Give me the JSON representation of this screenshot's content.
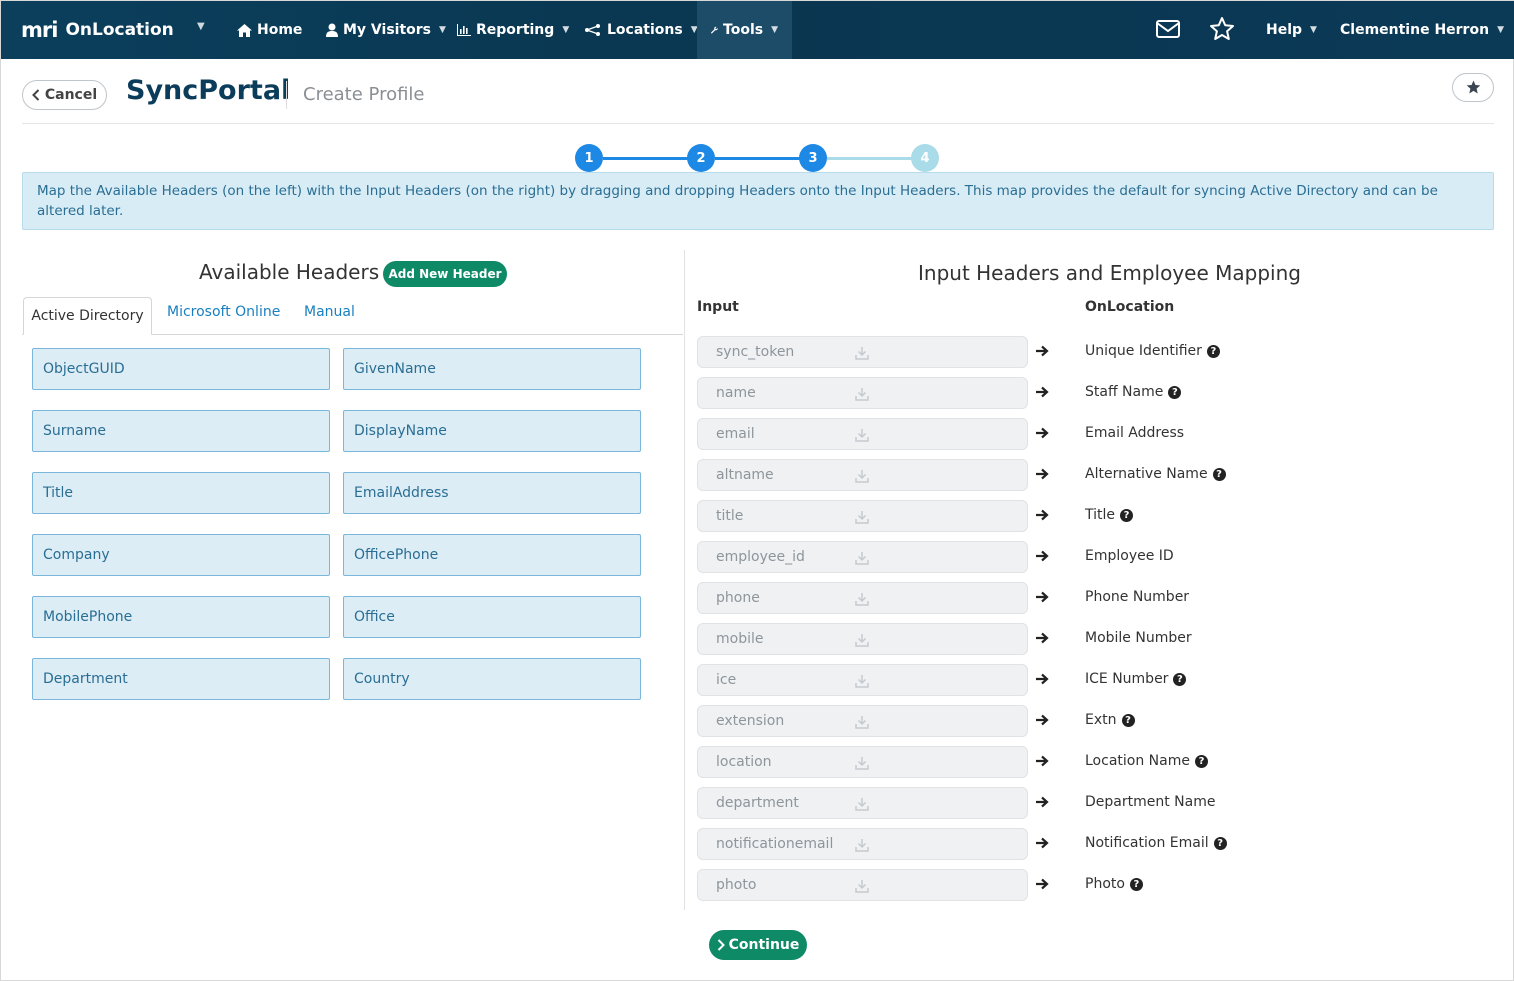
{
  "nav": {
    "brand_logo": "mri",
    "brand_name": "OnLocation",
    "items": [
      {
        "label": "Home",
        "icon": "home-icon"
      },
      {
        "label": "My Visitors",
        "icon": "user-icon"
      },
      {
        "label": "Reporting",
        "icon": "bar-chart-icon"
      },
      {
        "label": "Locations",
        "icon": "nodes-icon"
      },
      {
        "label": "Tools",
        "icon": "wrench-icon"
      }
    ],
    "help_label": "Help",
    "user_label": "Clementine Herron"
  },
  "header": {
    "cancel_label": "Cancel",
    "title": "SyncPortal",
    "subtitle": "Create Profile"
  },
  "stepper": {
    "steps": [
      "1",
      "2",
      "3",
      "4"
    ],
    "current_step": 3,
    "active_color": "#1e88e5",
    "inactive_color": "#a9dbe9"
  },
  "info_text": "Map the Available Headers (on the left) with the Input Headers (on the right) by dragging and dropping Headers onto the Input Headers. This map provides the default for syncing Active Directory and can be altered later.",
  "available": {
    "title": "Available Headers",
    "add_button": "Add New Header",
    "tabs": [
      "Active Directory",
      "Microsoft Online",
      "Manual"
    ],
    "active_tab": "Active Directory",
    "headers": [
      "ObjectGUID",
      "GivenName",
      "Surname",
      "DisplayName",
      "Title",
      "EmailAddress",
      "Company",
      "OfficePhone",
      "MobilePhone",
      "Office",
      "Department",
      "Country"
    ]
  },
  "mapping": {
    "title": "Input Headers and Employee Mapping",
    "input_col": "Input",
    "onlocation_col": "OnLocation",
    "rows": [
      {
        "input": "sync_token",
        "target": "Unique Identifier",
        "help": true
      },
      {
        "input": "name",
        "target": "Staff Name",
        "help": true
      },
      {
        "input": "email",
        "target": "Email Address",
        "help": false
      },
      {
        "input": "altname",
        "target": "Alternative Name",
        "help": true
      },
      {
        "input": "title",
        "target": "Title",
        "help": true
      },
      {
        "input": "employee_id",
        "target": "Employee ID",
        "help": false
      },
      {
        "input": "phone",
        "target": "Phone Number",
        "help": false
      },
      {
        "input": "mobile",
        "target": "Mobile Number",
        "help": false
      },
      {
        "input": "ice",
        "target": "ICE Number",
        "help": true
      },
      {
        "input": "extension",
        "target": "Extn",
        "help": true
      },
      {
        "input": "location",
        "target": "Location Name",
        "help": true
      },
      {
        "input": "department",
        "target": "Department Name",
        "help": false
      },
      {
        "input": "notificationemail",
        "target": "Notification Email",
        "help": true
      },
      {
        "input": "photo",
        "target": "Photo",
        "help": true
      }
    ]
  },
  "continue_label": "Continue"
}
